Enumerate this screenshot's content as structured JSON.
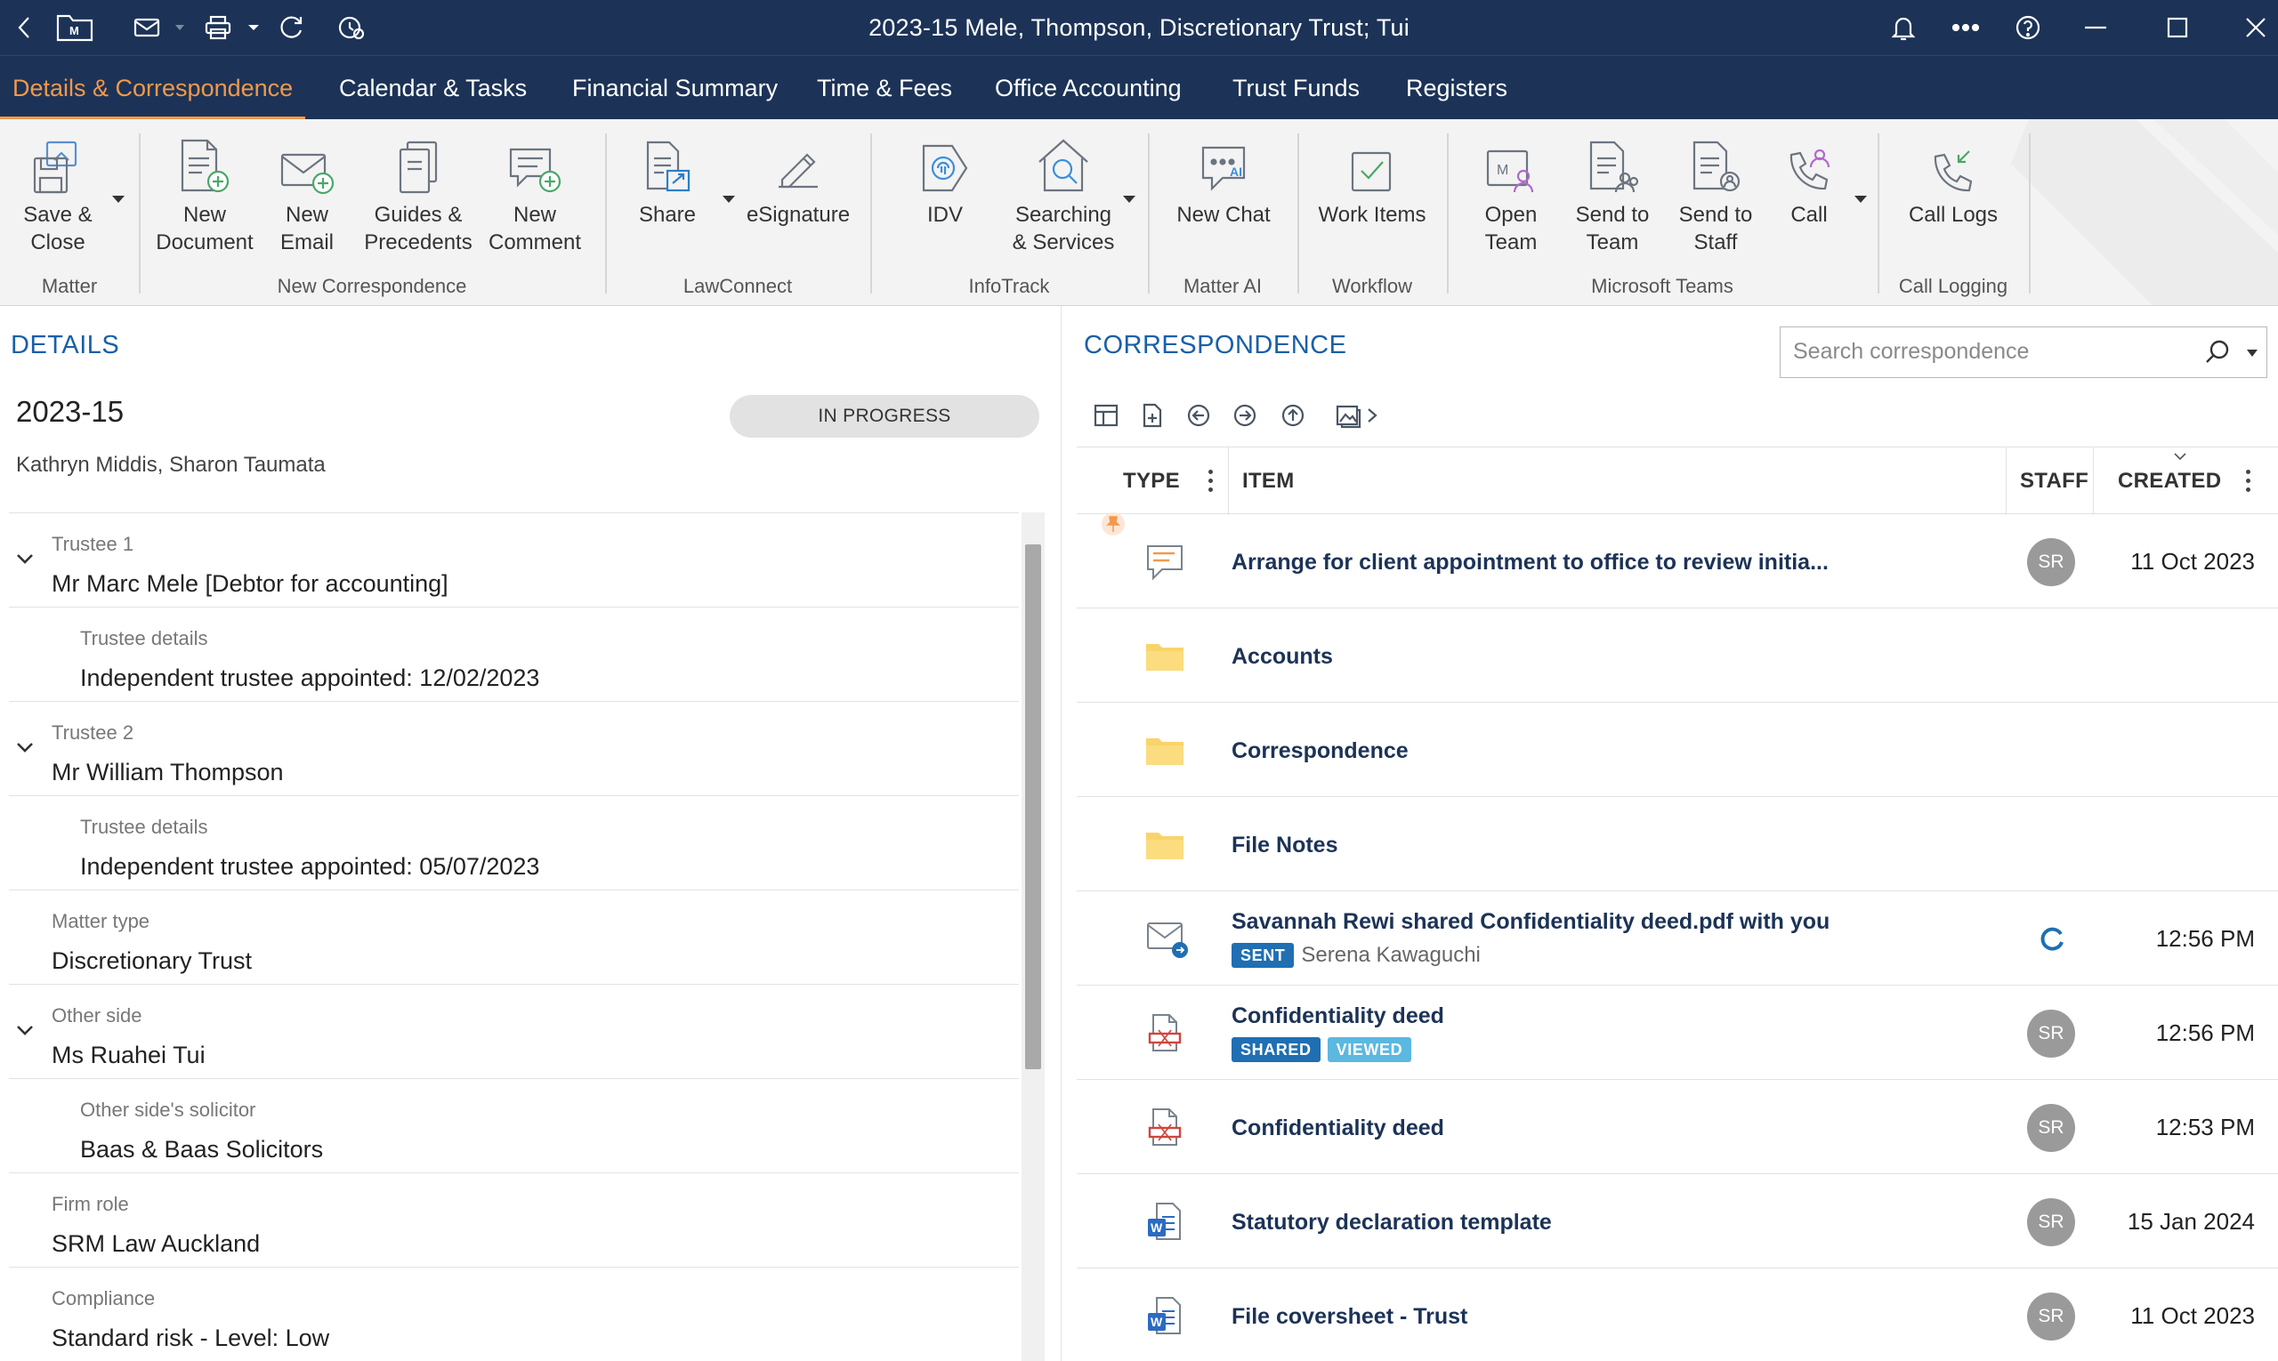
{
  "window": {
    "title": "2023-15 Mele, Thompson, Discretionary Trust; Tui"
  },
  "tabs": [
    {
      "label": "Details & Correspondence",
      "active": true
    },
    {
      "label": "Calendar & Tasks"
    },
    {
      "label": "Financial Summary"
    },
    {
      "label": "Time & Fees"
    },
    {
      "label": "Office Accounting"
    },
    {
      "label": "Trust Funds"
    },
    {
      "label": "Registers"
    }
  ],
  "ribbon": {
    "buttons": {
      "save_close": "Save &\nClose",
      "new_document": "New\nDocument",
      "new_email": "New\nEmail",
      "guides_precedents": "Guides &\nPrecedents",
      "new_comment": "New\nComment",
      "share": "Share",
      "esignature": "eSignature",
      "idv": "IDV",
      "searching_services": "Searching\n& Services",
      "new_chat": "New Chat",
      "work_items": "Work Items",
      "open_team": "Open\nTeam",
      "send_to_team": "Send to\nTeam",
      "send_to_staff": "Send to\nStaff",
      "call": "Call",
      "call_logs": "Call Logs"
    },
    "groups": {
      "matter": "Matter",
      "new_correspondence": "New Correspondence",
      "lawconnect": "LawConnect",
      "infotrack": "InfoTrack",
      "matter_ai": "Matter AI",
      "workflow": "Workflow",
      "microsoft_teams": "Microsoft  Teams",
      "call_logging": "Call Logging"
    }
  },
  "details": {
    "heading": "DETAILS",
    "matter_number": "2023-15",
    "status": "IN PROGRESS",
    "staff": "Kathryn Middis, Sharon Taumata",
    "rows": [
      {
        "label": "Trustee 1",
        "value": "Mr Marc Mele [Debtor for accounting]"
      },
      {
        "label": "Trustee details",
        "value": "Independent trustee appointed: 12/02/2023"
      },
      {
        "label": "Trustee 2",
        "value": "Mr William Thompson"
      },
      {
        "label": "Trustee details",
        "value": "Independent trustee appointed: 05/07/2023"
      },
      {
        "label": "Matter type",
        "value": "Discretionary Trust"
      },
      {
        "label": "Other side",
        "value": "Ms Ruahei Tui"
      },
      {
        "label": "Other side's solicitor",
        "value": "Baas & Baas Solicitors"
      },
      {
        "label": "Firm role",
        "value": "SRM Law Auckland"
      },
      {
        "label": "Compliance",
        "value": "Standard risk - Level: Low"
      }
    ]
  },
  "correspondence": {
    "heading": "CORRESPONDENCE",
    "search_placeholder": "Search correspondence",
    "columns": {
      "type": "TYPE",
      "item": "ITEM",
      "staff": "STAFF",
      "created": "CREATED"
    },
    "items": [
      {
        "type": "comment-icon",
        "title": "Arrange for client appointment to office to review initia...",
        "staff": "SR",
        "created": "11 Oct 2023",
        "pinned": true
      },
      {
        "type": "folder-icon",
        "title": "Accounts"
      },
      {
        "type": "folder-icon",
        "title": "Correspondence"
      },
      {
        "type": "folder-icon",
        "title": "File Notes"
      },
      {
        "type": "email-sent-icon",
        "title": "Savannah Rewi shared Confidentiality deed.pdf with you",
        "badges": [
          "SENT"
        ],
        "subtitle": "Serena Kawaguchi",
        "created": "12:56 PM"
      },
      {
        "type": "pdf-icon",
        "title": "Confidentiality deed",
        "badges": [
          "SHARED",
          "VIEWED"
        ],
        "staff": "SR",
        "created": "12:56 PM"
      },
      {
        "type": "pdf-icon",
        "title": "Confidentiality deed",
        "staff": "SR",
        "created": "12:53 PM"
      },
      {
        "type": "word-icon",
        "title": "Statutory declaration template",
        "staff": "SR",
        "created": "15 Jan 2024"
      },
      {
        "type": "word-icon",
        "title": "File coversheet - Trust",
        "staff": "SR",
        "created": "11 Oct 2023"
      }
    ]
  },
  "colors": {
    "titlebar": "#1c3357",
    "active_tab": "#f2994a",
    "heading": "#1a5fa8",
    "badge_sent": "#1f6fb2",
    "badge_shared": "#1f6fb2",
    "badge_viewed": "#5bb8e0"
  }
}
